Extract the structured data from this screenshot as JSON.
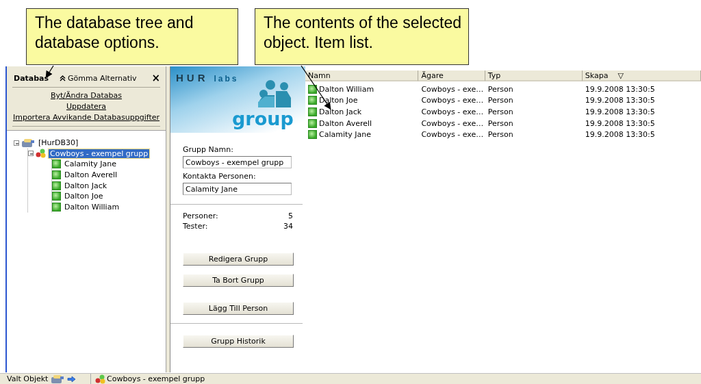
{
  "callouts": [
    {
      "text": "The database tree and database options."
    },
    {
      "text": "The contents of the selected object. Item list."
    }
  ],
  "left_panel": {
    "title": "Databas",
    "toggle": "Gömma Alternativ",
    "close": "×",
    "links": [
      "Byt/Ändra Databas",
      "Uppdatera",
      "Importera Avvikande Databasuppgifter"
    ],
    "tree": [
      {
        "label": "[HurDB30]",
        "kind": "database",
        "expanded": true,
        "selected": false,
        "children": [
          {
            "label": "Cowboys - exempel grupp",
            "kind": "group",
            "expanded": true,
            "selected": true,
            "children": [
              {
                "label": "Calamity Jane",
                "kind": "person",
                "selected": false
              },
              {
                "label": "Dalton Averell",
                "kind": "person",
                "selected": false
              },
              {
                "label": "Dalton Jack",
                "kind": "person",
                "selected": false
              },
              {
                "label": "Dalton Joe",
                "kind": "person",
                "selected": false
              },
              {
                "label": "Dalton William",
                "kind": "person",
                "selected": false
              }
            ]
          }
        ]
      }
    ]
  },
  "detail": {
    "logo": {
      "brand": "HUR",
      "sub": "labs",
      "word": "group"
    },
    "fields": [
      {
        "label": "Grupp Namn:",
        "value": "Cowboys - exempel grupp"
      },
      {
        "label": "Kontakta Personen:",
        "value": "Calamity Jane"
      }
    ],
    "stats": [
      {
        "label": "Personer:",
        "value": "5"
      },
      {
        "label": "Tester:",
        "value": "34"
      }
    ],
    "button_sections": [
      [
        [
          "Redigera Grupp",
          "Ta Bort Grupp"
        ],
        [
          "Lägg Till Person"
        ]
      ],
      [
        [
          "Grupp Historik"
        ]
      ]
    ]
  },
  "list": {
    "columns": [
      {
        "label": "Namn"
      },
      {
        "label": "Ägare"
      },
      {
        "label": "Typ"
      },
      {
        "label": "Skapa",
        "sort_mark": "▽"
      }
    ],
    "rows": [
      {
        "cells": [
          "Dalton William",
          "Cowboys - exe…",
          "Person",
          "19.9.2008 13:30:5"
        ]
      },
      {
        "cells": [
          "Dalton Joe",
          "Cowboys - exe…",
          "Person",
          "19.9.2008 13:30:5"
        ]
      },
      {
        "cells": [
          "Dalton Jack",
          "Cowboys - exe…",
          "Person",
          "19.9.2008 13:30:5"
        ]
      },
      {
        "cells": [
          "Dalton Averell",
          "Cowboys - exe…",
          "Person",
          "19.9.2008 13:30:5"
        ]
      },
      {
        "cells": [
          "Calamity Jane",
          "Cowboys - exe…",
          "Person",
          "19.9.2008 13:30:5"
        ]
      }
    ]
  },
  "status_bar": {
    "label": "Valt Objekt",
    "value": "Cowboys - exempel grupp"
  }
}
